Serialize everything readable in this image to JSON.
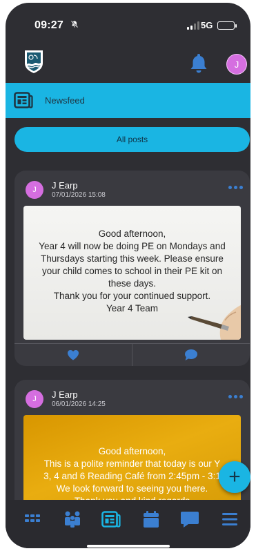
{
  "status_bar": {
    "time": "09:27",
    "network": "5G"
  },
  "header": {
    "avatar_initial": "J"
  },
  "section": {
    "title": "Newsfeed"
  },
  "filter": {
    "label": "All posts"
  },
  "posts": [
    {
      "avatar_initial": "J",
      "author": "J Earp",
      "date": "07/01/2026 15:08",
      "lines": [
        "Good afternoon,",
        "Year 4 will now be doing PE on Mondays and",
        "Thursdays starting this week. Please ensure",
        "your child comes to school in their PE kit on",
        "these days.",
        "Thank you for your continued support.",
        "Year 4 Team"
      ]
    },
    {
      "avatar_initial": "J",
      "author": "J Earp",
      "date": "06/01/2026 14:25",
      "lines": [
        "Good afternoon,",
        "This is a polite reminder that today is our Y",
        "3, 4 and 6 Reading Café from 2:45pm - 3:1",
        "We look forward to seeing you there.",
        "Thank you and kind regards"
      ]
    }
  ],
  "fab": {
    "label": "+"
  },
  "colors": {
    "accent": "#1ab5e3",
    "background": "#2e2e33",
    "card": "#3a3a40",
    "icon_blue": "#3b7fd1",
    "avatar": "#d56ee0"
  },
  "nav_icons": [
    "grid-icon",
    "people-icon",
    "newsfeed-icon",
    "calendar-icon",
    "chat-icon",
    "menu-icon"
  ]
}
